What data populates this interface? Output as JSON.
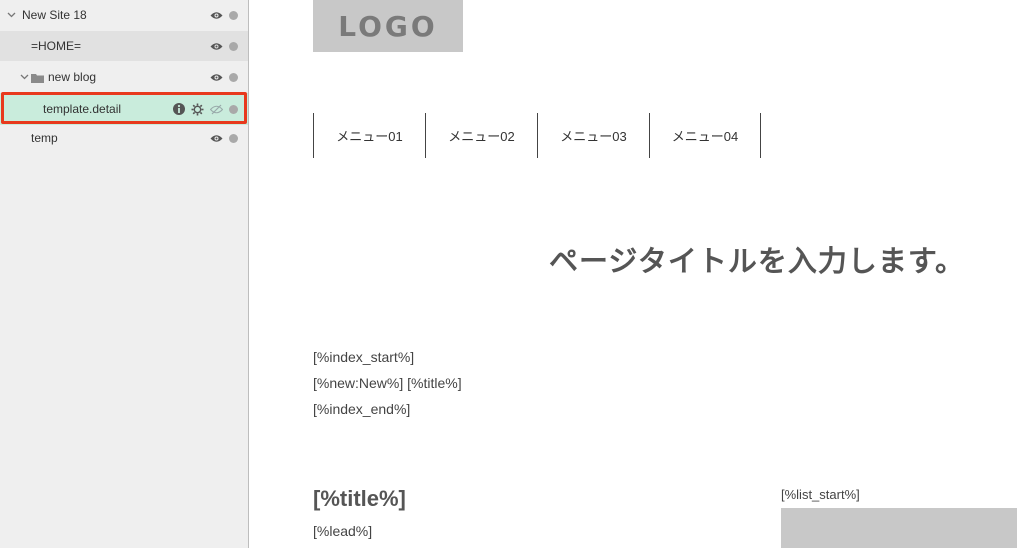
{
  "sidebar": {
    "items": [
      {
        "label": "New Site 18",
        "level": 0,
        "expanded": true
      },
      {
        "label": "=HOME=",
        "level": 1
      },
      {
        "label": "new blog",
        "level": 1,
        "type": "folder",
        "expanded": true
      },
      {
        "label": "template.detail",
        "level": 2,
        "selected": true
      },
      {
        "label": "temp",
        "level": 1
      }
    ],
    "selected_color": "#c9ecdc",
    "highlight_color": "#e8391d"
  },
  "canvas": {
    "logo": "LOGO",
    "nav": [
      "メニュー01",
      "メニュー02",
      "メニュー03",
      "メニュー04"
    ],
    "page_title": "ページタイトルを入力します。",
    "index_block": [
      "[%index_start%]",
      "[%new:New%] [%title%]",
      "[%index_end%]"
    ],
    "article_title": "[%title%]",
    "article_lead": "[%lead%]",
    "list_start": "[%list_start%]"
  }
}
